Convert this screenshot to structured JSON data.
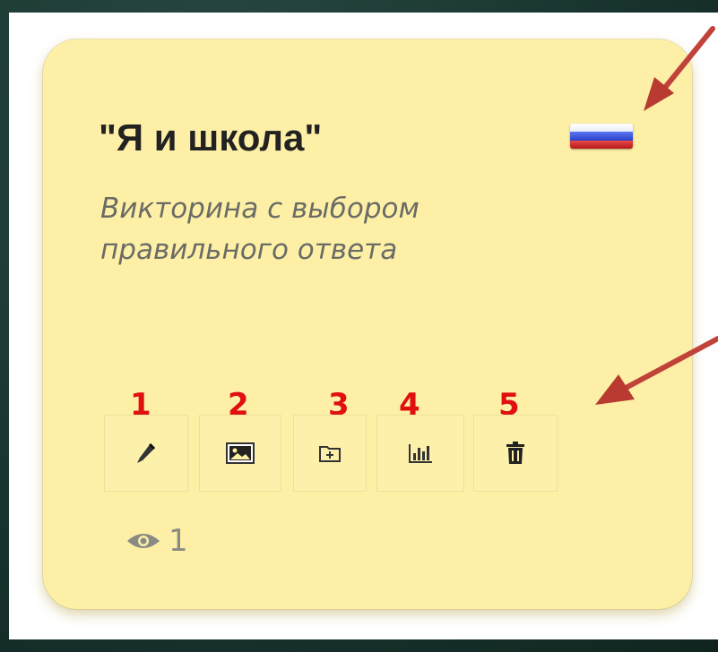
{
  "card": {
    "title": "\"Я и школа\"",
    "subtitle": "Викторина с выбором правильного ответа",
    "flag": {
      "colors": [
        "#ffffff",
        "#2f4bd1",
        "#d42323"
      ]
    },
    "view_count": "1"
  },
  "toolbar": {
    "buttons": [
      {
        "number": "1",
        "icon": "pencil-icon"
      },
      {
        "number": "2",
        "icon": "image-icon"
      },
      {
        "number": "3",
        "icon": "folder-add-icon"
      },
      {
        "number": "4",
        "icon": "stats-icon"
      },
      {
        "number": "5",
        "icon": "trash-icon"
      }
    ]
  },
  "colors": {
    "card_bg": "#fdf0a6",
    "number_label": "#e01010",
    "arrow": "#c0392b"
  }
}
